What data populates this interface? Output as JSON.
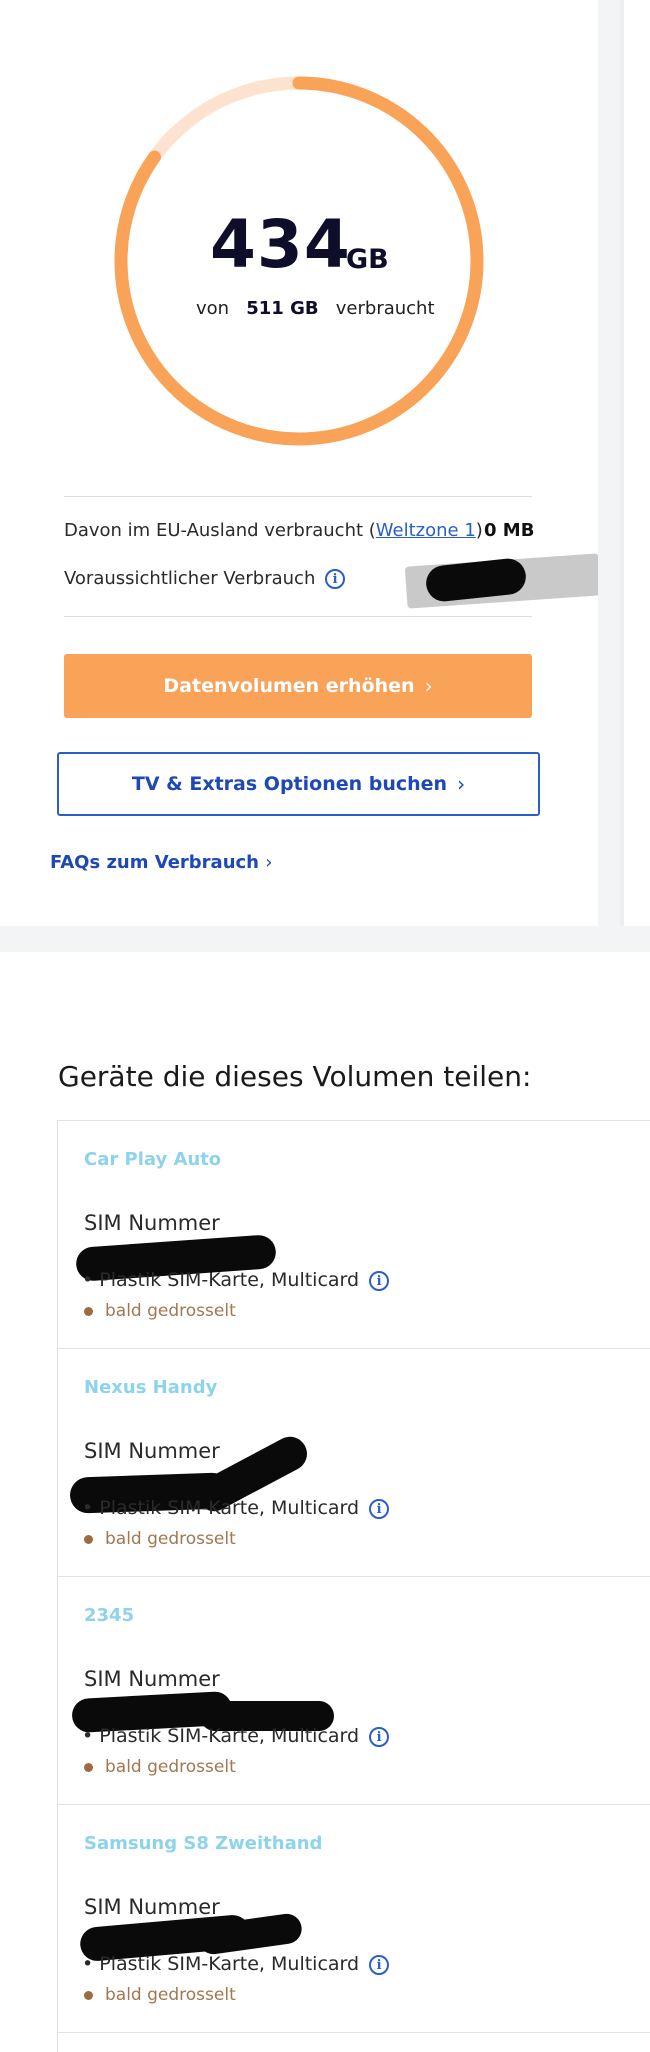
{
  "usage": {
    "used_value": "434",
    "used_unit": "GB",
    "sub_prefix": "von",
    "total": "511 GB",
    "sub_suffix": "verbraucht",
    "used_fraction": 0.849,
    "arc_color": "#f9a359",
    "arc_track_color": "#fde3cf"
  },
  "details": {
    "eu_label_prefix": "Davon im EU-Ausland verbraucht (",
    "eu_link": "Weltzone 1",
    "eu_label_suffix": ")",
    "eu_value": "0 MB",
    "forecast_label": "Voraussichtlicher Verbrauch",
    "info_icon": "i"
  },
  "actions": {
    "primary_label": "Datenvolumen erhöhen",
    "secondary_label": "TV & Extras Optionen buchen",
    "faq_label": "FAQs zum Verbrauch",
    "chevron": "›",
    "primary_color": "#f9a359",
    "link_color": "#1d48b5"
  },
  "devices_section": {
    "title": "Geräte die dieses Volumen teilen:",
    "devices": [
      {
        "name": "Car Play Auto",
        "sim_label": "SIM Nummer",
        "sim_type": "• Plastik SIM-Karte, Multicard",
        "status": "bald gedrosselt"
      },
      {
        "name": "Nexus Handy",
        "sim_label": "SIM Nummer",
        "sim_type": "• Plastik SIM-Karte, Multicard",
        "status": "bald gedrosselt"
      },
      {
        "name": "2345",
        "sim_label": "SIM Nummer",
        "sim_type": "• Plastik SIM-Karte, Multicard",
        "status": "bald gedrosselt"
      },
      {
        "name": "Samsung S8 Zweithand",
        "sim_label": "SIM Nummer",
        "sim_type": "• Plastik SIM-Karte, Multicard",
        "status": "bald gedrosselt"
      }
    ]
  }
}
